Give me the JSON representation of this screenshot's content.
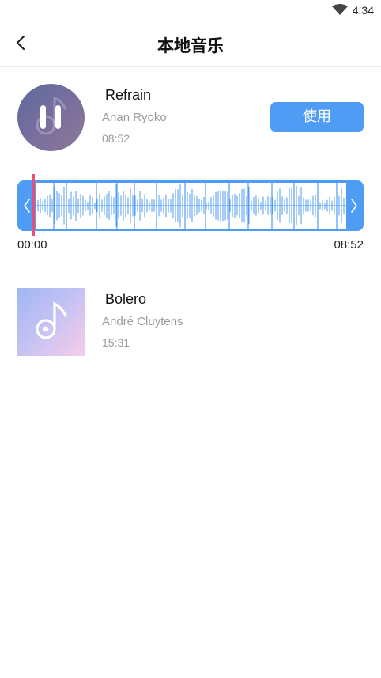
{
  "status_bar": {
    "time": "4:34",
    "icons": [
      "wifi-icon"
    ]
  },
  "header": {
    "title": "本地音乐",
    "back_icon": "chevron-left-icon"
  },
  "songs": [
    {
      "title": "Refrain",
      "artist": "Anan Ryoko",
      "duration": "08:52",
      "state": "playing",
      "cover_icon": "pause-icon",
      "action_label": "使用",
      "accent_color": "#4f9cf4"
    },
    {
      "title": "Bolero",
      "artist": "André Cluytens",
      "duration": "15:31",
      "cover_icon": "music-note-icon"
    }
  ],
  "trimmer": {
    "start_time": "00:00",
    "end_time": "08:52",
    "playhead_color": "#e8507a",
    "left_handle_icon": "chevron-left-icon",
    "right_handle_icon": "chevron-right-icon"
  }
}
